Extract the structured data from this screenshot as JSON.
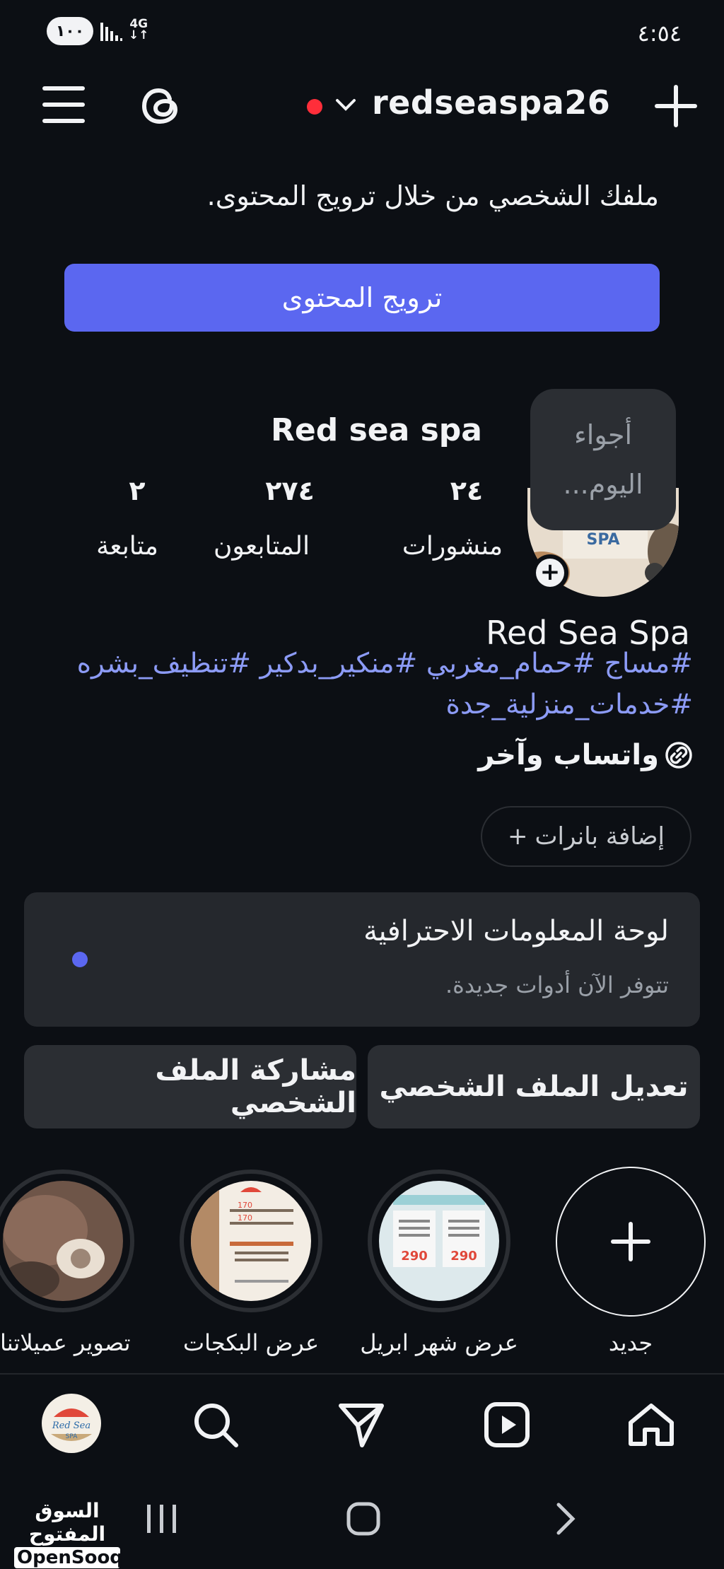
{
  "status_bar": {
    "battery": "١٠٠",
    "network": "4G",
    "time": "٤:٥٤"
  },
  "header": {
    "username": "redseaspa26"
  },
  "promo": {
    "text": "ملفك الشخصي من خلال ترويج المحتوى.",
    "button_label": "ترويج المحتوى"
  },
  "profile": {
    "note_line1": "أجواء",
    "note_line2": "اليوم...",
    "display_name": "Red sea spa",
    "stats": [
      {
        "value": "٢٤",
        "label": "منشورات"
      },
      {
        "value": "٢٧٤",
        "label": "المتابعون"
      },
      {
        "value": "٢",
        "label": "متابعة"
      }
    ],
    "full_name": "Red Sea Spa",
    "bio_line1": "#مساج #حمام_مغربي #منكير_بدكير #تنظيف_بشره",
    "bio_line2": "#خدمات_منزلية_جدة",
    "link_text": "واتساب وآخر",
    "add_banners_label": "إضافة بانرات"
  },
  "dashboard": {
    "title": "لوحة المعلومات الاحترافية",
    "subtitle": "تتوفر الآن أدوات جديدة."
  },
  "actions": {
    "edit_profile": "تعديل الملف الشخصي",
    "share_profile": "مشاركة الملف الشخصي"
  },
  "highlights": [
    {
      "label": "جديد",
      "icon": "plus-icon"
    },
    {
      "label": "عرض شهر ابريل",
      "prices": [
        "290",
        "290"
      ]
    },
    {
      "label": "عرض البكجات",
      "prices": [
        "170",
        "170"
      ]
    },
    {
      "label": "تصوير عميلاتنا"
    }
  ],
  "bottom_nav": [
    {
      "name": "home-icon"
    },
    {
      "name": "reels-icon"
    },
    {
      "name": "direct-icon"
    },
    {
      "name": "search-icon"
    },
    {
      "name": "profile-avatar"
    }
  ],
  "watermark": {
    "arabic": "السوق المفتوح",
    "english": "OpenSooq"
  },
  "colors": {
    "background": "#0c0f14",
    "accent": "#5b67f0",
    "card": "#25282d",
    "hashtag": "#8c9bf6",
    "live_dot": "#ff2e3a"
  }
}
